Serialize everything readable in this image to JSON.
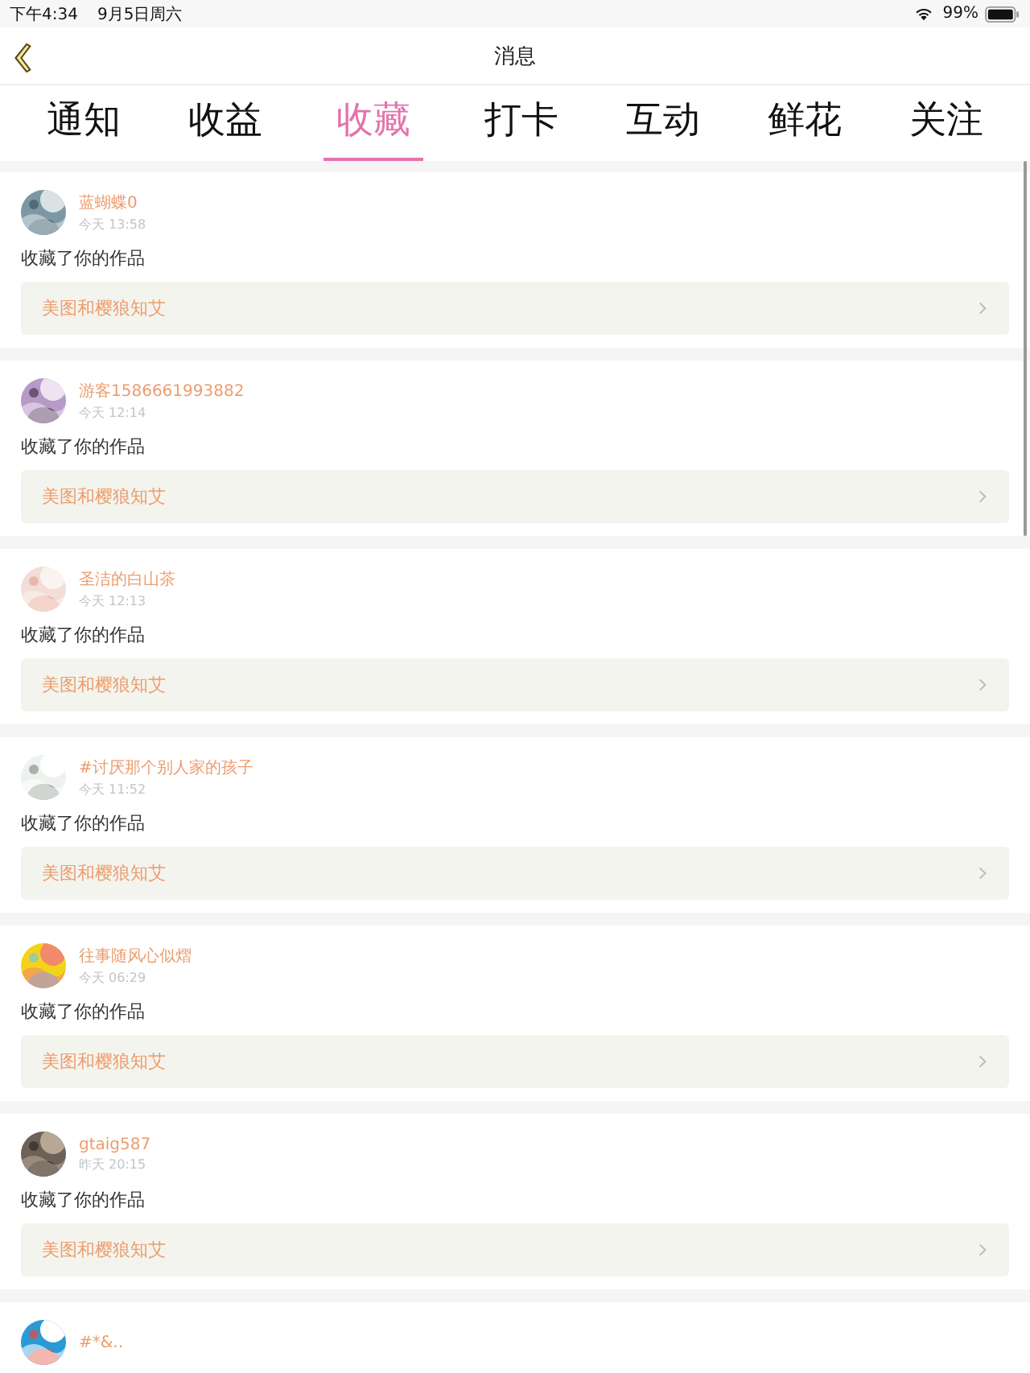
{
  "status_bar": {
    "time": "下午4:34",
    "date": "9月5日周六",
    "battery": "99%"
  },
  "nav": {
    "title": "消息"
  },
  "tabs": [
    {
      "label": "通知",
      "selected": false
    },
    {
      "label": "收益",
      "selected": false
    },
    {
      "label": "收藏",
      "selected": true
    },
    {
      "label": "打卡",
      "selected": false
    },
    {
      "label": "互动",
      "selected": false
    },
    {
      "label": "鲜花",
      "selected": false
    },
    {
      "label": "关注",
      "selected": false
    }
  ],
  "messages": [
    {
      "user": "蓝蝴蝶0",
      "time": "今天 13:58",
      "text": "收藏了你的作品",
      "work": "美图和樱狼知艾"
    },
    {
      "user": "游客1586661993882",
      "time": "今天 12:14",
      "text": "收藏了你的作品",
      "work": "美图和樱狼知艾"
    },
    {
      "user": "圣洁的白山茶",
      "time": "今天 12:13",
      "text": "收藏了你的作品",
      "work": "美图和樱狼知艾"
    },
    {
      "user": "#讨厌那个别人家的孩子",
      "time": "今天 11:52",
      "text": "收藏了你的作品",
      "work": "美图和樱狼知艾"
    },
    {
      "user": "往事随风心似熠",
      "time": "今天 06:29",
      "text": "收藏了你的作品",
      "work": "美图和樱狼知艾"
    },
    {
      "user": "gtaig587",
      "time": "昨天 20:15",
      "text": "收藏了你的作品",
      "work": "美图和樱狼知艾"
    },
    {
      "user": "#*&.."
    }
  ]
}
